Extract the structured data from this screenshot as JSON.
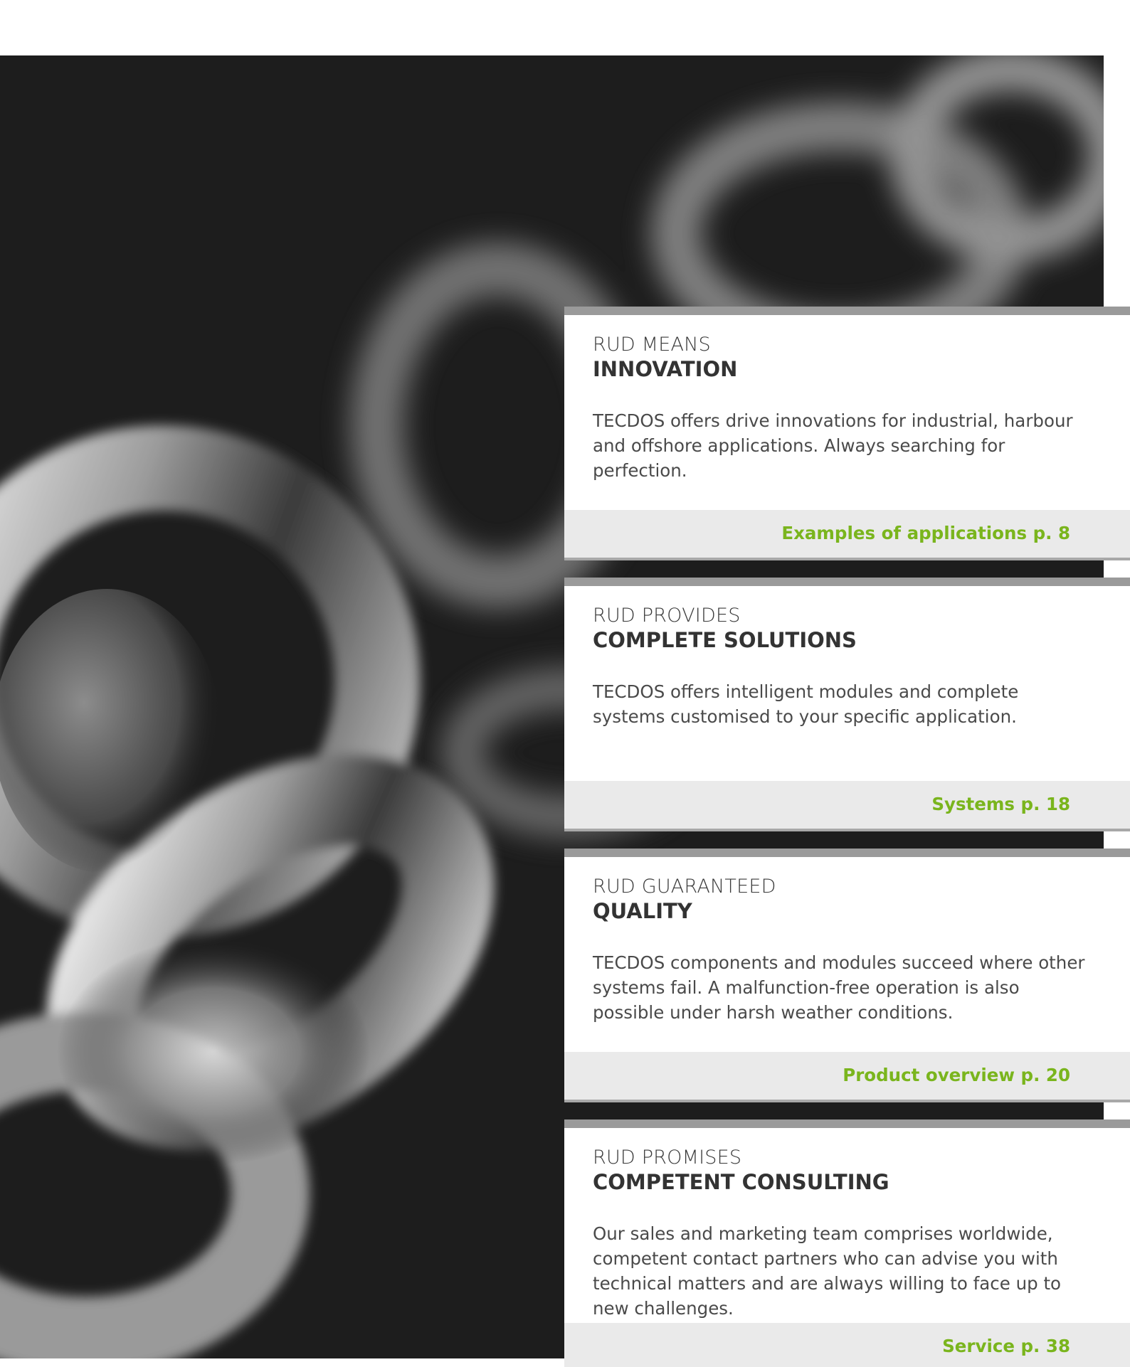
{
  "cards": [
    {
      "kicker": "RUD MEANS",
      "headline": "INNOVATION",
      "text": "TECDOS offers drive innovations for industrial, harbour and offshore applications. Always searching for perfection.",
      "link": "Examples of applications p. 8"
    },
    {
      "kicker": "RUD PROVIDES",
      "headline": "COMPLETE SOLUTIONS",
      "text": "TECDOS offers intelligent modules and complete systems customised to your specific application.",
      "link": "Systems p. 18"
    },
    {
      "kicker": "RUD GUARANTEED",
      "headline": "QUALITY",
      "text": "TECDOS components and modules succeed where other systems fail. A malfunction-free operation is also possible under harsh weather conditions.",
      "link": "Product overview p. 20"
    },
    {
      "kicker": "RUD PROMISES",
      "headline": "COMPETENT CONSULTING",
      "text": "Our sales and marketing team comprises worldwide, competent contact partners who can advise you with technical matters and are always willing to face up to new challenges.",
      "link": "Service p. 38"
    }
  ],
  "colors": {
    "accent": "#7ab51d",
    "bar": "#9a9a9a",
    "footer": "#eaeaea",
    "photo_bg": "#1d1d1d"
  }
}
